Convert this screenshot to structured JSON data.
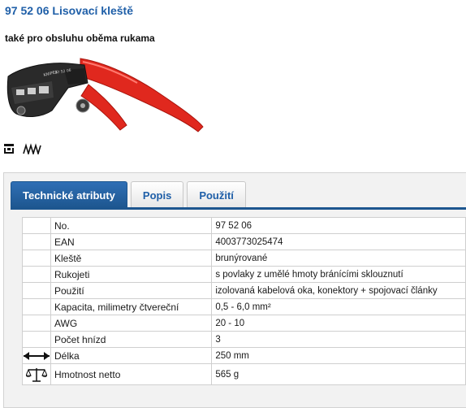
{
  "product": {
    "title": "97 52 06 Lisovací kleště",
    "subtitle": "také pro obsluhu oběma rukama",
    "image_icon": "crimping-pliers-image",
    "feature_icons": [
      "crimp-profile-icon",
      "zigzag-teeth-icon"
    ],
    "brand_mark": "KNIPEX",
    "engraving": "97 52 06"
  },
  "tabs": [
    {
      "label": "Technické atributy",
      "active": true
    },
    {
      "label": "Popis",
      "active": false
    },
    {
      "label": "Použití",
      "active": false
    }
  ],
  "attributes": [
    {
      "label": "No.",
      "value": "97 52 06",
      "icon": ""
    },
    {
      "label": "EAN",
      "value": "4003773025474",
      "icon": ""
    },
    {
      "label": "Kleště",
      "value": "brunýrované",
      "icon": ""
    },
    {
      "label": "Rukojeti",
      "value": "s povlaky z umělé hmoty bránícími sklouznutí",
      "icon": ""
    },
    {
      "label": "Použití",
      "value": "izolovaná kabelová oka, konektory + spojovací články",
      "icon": ""
    },
    {
      "label": "Kapacita, milimetry čtvereční",
      "value": "0,5 - 6,0 mm²",
      "icon": ""
    },
    {
      "label": "AWG",
      "value": "20 - 10",
      "icon": ""
    },
    {
      "label": "Počet hnízd",
      "value": "3",
      "icon": ""
    },
    {
      "label": "Délka",
      "value": "250 mm",
      "icon": "length-arrow-icon"
    },
    {
      "label": "Hmotnost netto",
      "value": "565 g",
      "icon": "scale-icon"
    }
  ],
  "colors": {
    "brand_blue": "#1f5fa8",
    "tab_active": "#1d568f",
    "handle_red": "#e0281e"
  }
}
